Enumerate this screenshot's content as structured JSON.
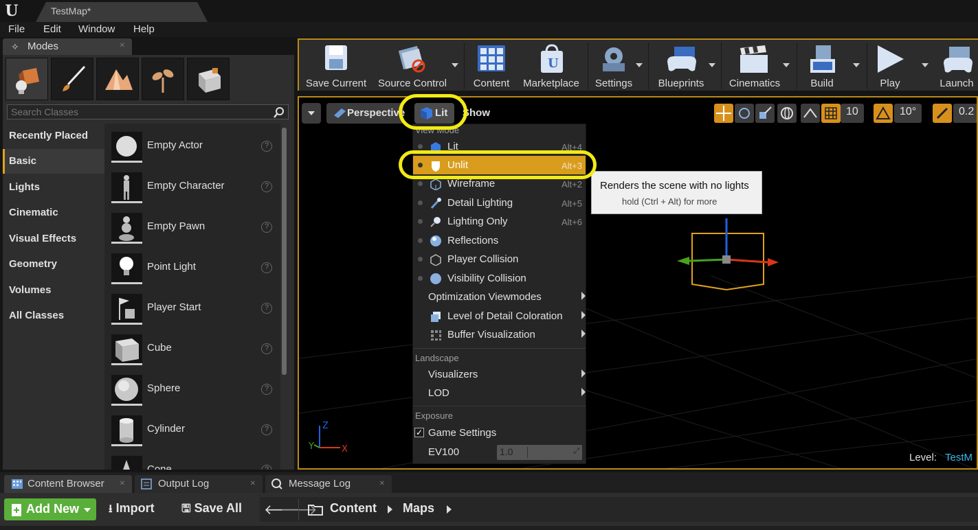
{
  "title_bar": {
    "logo": "U",
    "doc_tab": "TestMap*"
  },
  "menu": [
    "File",
    "Edit",
    "Window",
    "Help"
  ],
  "modes": {
    "tab_label": "Modes",
    "search_placeholder": "Search Classes",
    "categories": [
      "Recently Placed",
      "Basic",
      "Lights",
      "Cinematic",
      "Visual Effects",
      "Geometry",
      "Volumes",
      "All Classes"
    ],
    "active_category": "Basic",
    "classes": [
      "Empty Actor",
      "Empty Character",
      "Empty Pawn",
      "Point Light",
      "Player Start",
      "Cube",
      "Sphere",
      "Cylinder",
      "Cone"
    ],
    "help_glyph": "?"
  },
  "toolbar": {
    "save_current": "Save Current",
    "source_control": "Source Control",
    "content": "Content",
    "marketplace": "Marketplace",
    "settings": "Settings",
    "blueprints": "Blueprints",
    "cinematics": "Cinematics",
    "build": "Build",
    "play": "Play",
    "launch": "Launch"
  },
  "viewport": {
    "perspective": "Perspective",
    "lit": "Lit",
    "show": "Show",
    "grid_snap": "10",
    "rot_snap": "10°",
    "scale_snap": "0.2",
    "level_label": "Level:",
    "level_name": "TestM"
  },
  "view_mode_menu": {
    "header": "View Mode",
    "items": [
      {
        "label": "Lit",
        "shortcut": "Alt+4"
      },
      {
        "label": "Unlit",
        "shortcut": "Alt+3"
      },
      {
        "label": "Wireframe",
        "shortcut": "Alt+2"
      },
      {
        "label": "Detail Lighting",
        "shortcut": "Alt+5"
      },
      {
        "label": "Lighting Only",
        "shortcut": "Alt+6"
      },
      {
        "label": "Reflections",
        "shortcut": ""
      },
      {
        "label": "Player Collision",
        "shortcut": ""
      },
      {
        "label": "Visibility Collision",
        "shortcut": ""
      }
    ],
    "optimization": "Optimization Viewmodes",
    "lod_coloration": "Level of Detail Coloration",
    "buffer_vis": "Buffer Visualization",
    "landscape_header": "Landscape",
    "visualizers": "Visualizers",
    "lod": "LOD",
    "exposure_header": "Exposure",
    "game_settings": "Game Settings",
    "ev100_label": "EV100",
    "ev100_value": "1.0"
  },
  "tooltip": {
    "line1": "Renders the scene with no lights",
    "line2": "hold (Ctrl + Alt) for more"
  },
  "bottom": {
    "tabs": [
      "Content Browser",
      "Output Log",
      "Message Log"
    ],
    "add_new": "Add New",
    "import": "Import",
    "save_all": "Save All",
    "path": [
      "Content",
      "Maps"
    ]
  },
  "colors": {
    "accent": "#d99c1c",
    "highlight_ring": "#f2ea14",
    "add_new": "#5aae3a"
  }
}
